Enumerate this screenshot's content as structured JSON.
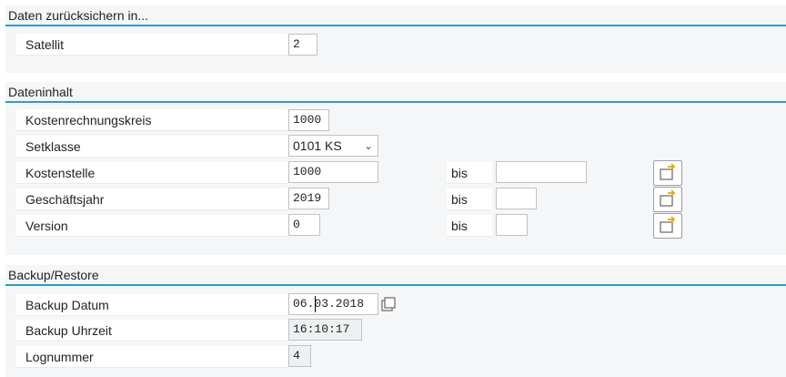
{
  "groups": {
    "restore_in": {
      "title": "Daten zurücksichern in...",
      "satellit_label": "Satellit",
      "satellit_value": "2"
    },
    "content": {
      "title": "Dateninhalt",
      "kostenrechnungskreis_label": "Kostenrechnungskreis",
      "kostenrechnungskreis_value": "1000",
      "setklasse_label": "Setklasse",
      "setklasse_value": "0101 KS",
      "kostenstelle_label": "Kostenstelle",
      "kostenstelle_value": "1000",
      "kostenstelle_bis": "",
      "geschaeftsjahr_label": "Geschäftsjahr",
      "geschaeftsjahr_value": "2019",
      "geschaeftsjahr_bis": "",
      "version_label": "Version",
      "version_value": "0",
      "version_bis": "",
      "bis_label": "bis"
    },
    "backup": {
      "title": "Backup/Restore",
      "datum_label": "Backup Datum",
      "datum_value": "06.03.2018",
      "uhrzeit_label": "Backup Uhrzeit",
      "uhrzeit_value": "16:10:17",
      "lognummer_label": "Lognummer",
      "lognummer_value": "4"
    }
  },
  "icons": {
    "multiple_selection": "multiple-selection-icon",
    "calendar": "calendar-icon",
    "dropdown": "chevron-down-icon"
  },
  "colors": {
    "accent": "#2b9bd6",
    "group_bg": "#f4f6f7",
    "arrow": "#f0a500"
  }
}
